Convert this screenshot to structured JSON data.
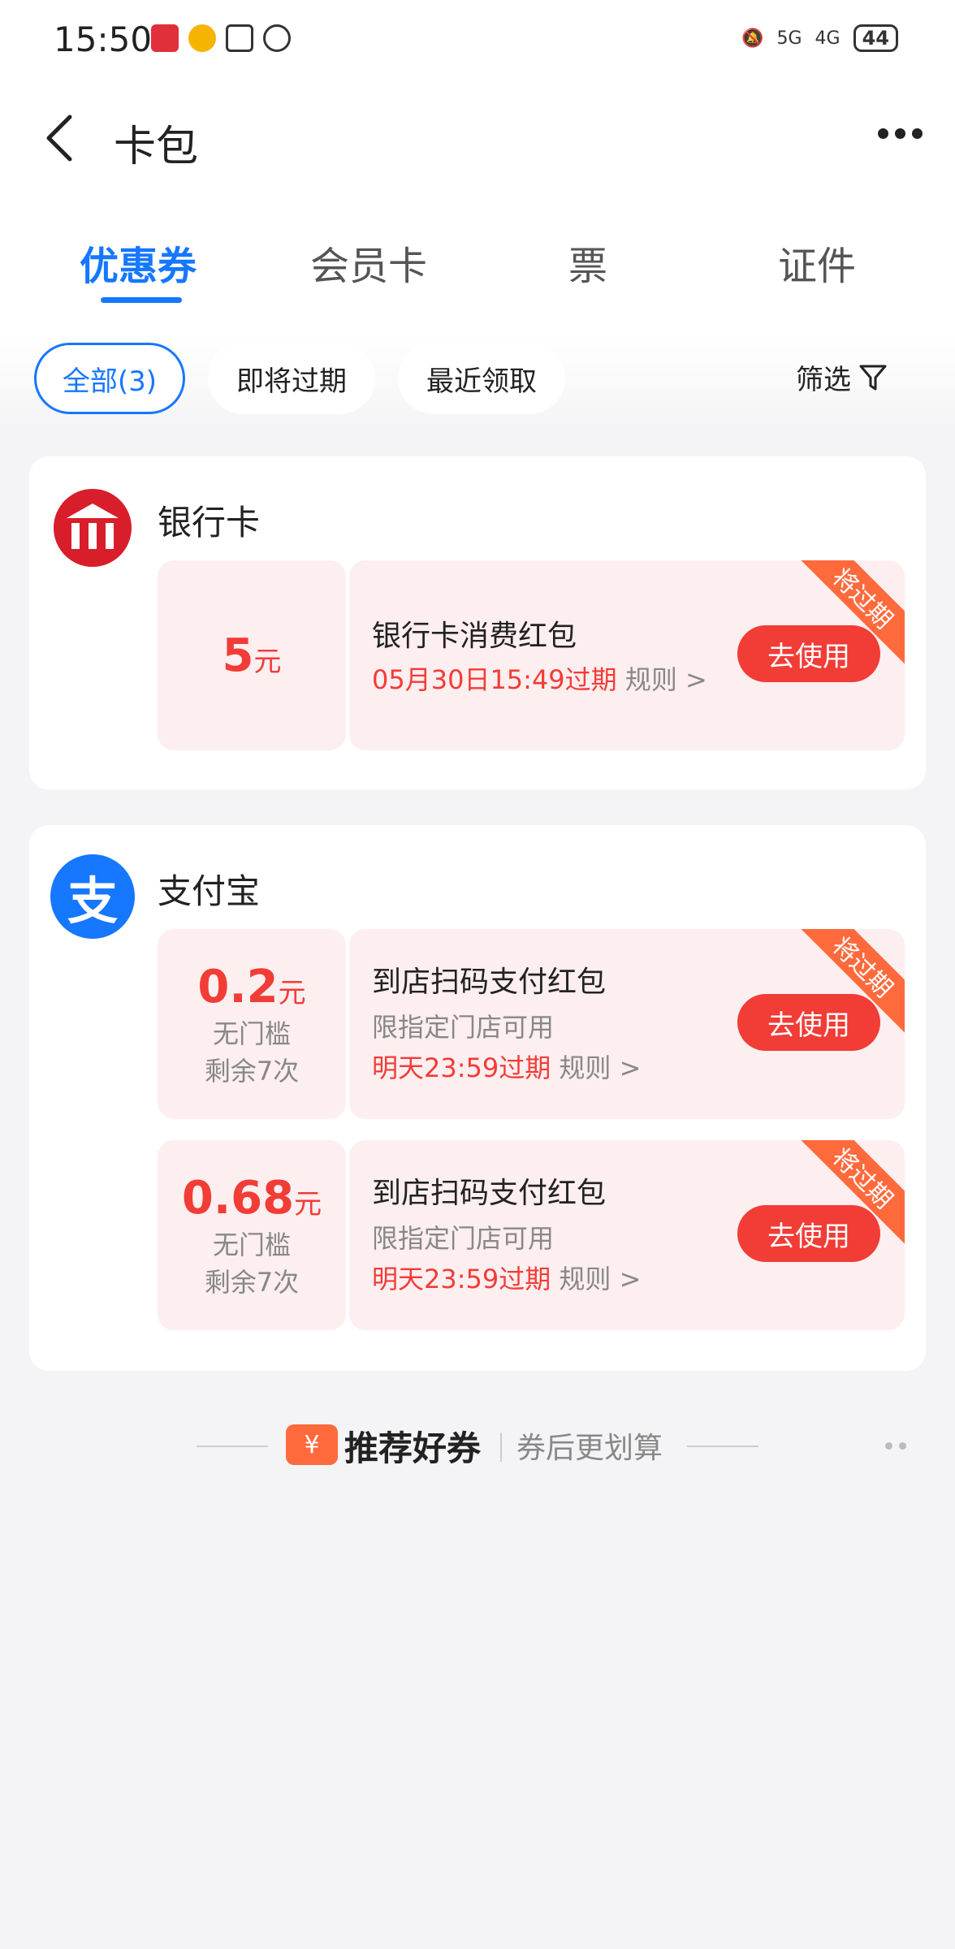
{
  "statusbar": {
    "time": "15:50",
    "battery": "44",
    "net1": "5G",
    "net2": "4G"
  },
  "header": {
    "title": "卡包"
  },
  "tabs": [
    {
      "label": "优惠券"
    },
    {
      "label": "会员卡"
    },
    {
      "label": "票"
    },
    {
      "label": "证件"
    }
  ],
  "filters": {
    "all": "全部(3)",
    "expiring": "即将过期",
    "recent": "最近领取",
    "filter": "筛选"
  },
  "bank": {
    "name": "银行卡",
    "coupon": {
      "amount": "5",
      "unit": "元",
      "title": "银行卡消费红包",
      "expire": "05月30日15:49过期",
      "rule": "规则 >",
      "button": "去使用",
      "ribbon": "将过期"
    }
  },
  "alipay": {
    "name": "支付宝",
    "logo_char": "支",
    "coupons": [
      {
        "amount": "0.2",
        "unit": "元",
        "sub1": "无门槛",
        "sub2": "剩余7次",
        "title": "到店扫码支付红包",
        "desc": "限指定门店可用",
        "expire": "明天23:59过期",
        "rule": "规则 >",
        "button": "去使用",
        "ribbon": "将过期"
      },
      {
        "amount": "0.68",
        "unit": "元",
        "sub1": "无门槛",
        "sub2": "剩余7次",
        "title": "到店扫码支付红包",
        "desc": "限指定门店可用",
        "expire": "明天23:59过期",
        "rule": "规则 >",
        "button": "去使用",
        "ribbon": "将过期"
      }
    ]
  },
  "recommend": {
    "badge": "¥",
    "title": "推荐好券",
    "sub": "券后更划算"
  },
  "colors": {
    "accent": "#1677ff",
    "red": "#f23c36",
    "orange": "#ff8a00"
  }
}
